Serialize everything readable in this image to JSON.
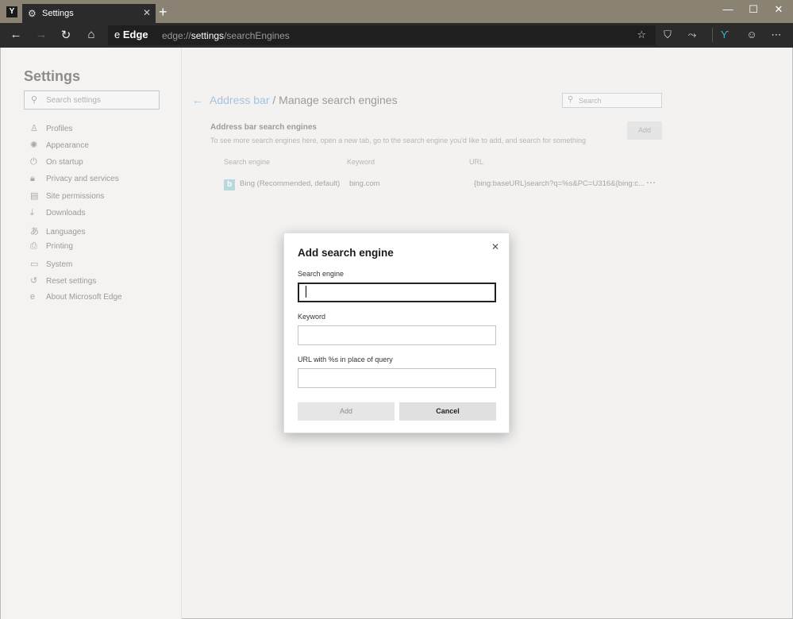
{
  "browser": {
    "tab_title": "Settings",
    "new_tab_symbol": "+",
    "address_brand": "Edge",
    "url_scheme": "edge://",
    "url_host": "settings",
    "url_path": "/searchEngines",
    "icons": [
      "settings-gear-icon",
      "tab-close-icon",
      "back-icon",
      "forward-icon",
      "refresh-icon",
      "home-icon",
      "favorite-star-icon",
      "shield-icon",
      "share-icon",
      "profile-icon",
      "emoji-icon",
      "more-icon"
    ]
  },
  "sidebar": {
    "title": "Settings",
    "search_placeholder": "Search settings",
    "items": [
      {
        "label": "Profiles",
        "icon": "person-icon"
      },
      {
        "label": "Appearance",
        "icon": "palette-icon"
      },
      {
        "label": "On startup",
        "icon": "power-icon"
      },
      {
        "label": "Privacy and services",
        "icon": "lock-icon"
      },
      {
        "label": "Site permissions",
        "icon": "permissions-icon"
      },
      {
        "label": "Downloads",
        "icon": "download-icon"
      },
      {
        "label": "Languages",
        "icon": "language-icon"
      },
      {
        "label": "Printing",
        "icon": "printer-icon"
      },
      {
        "label": "System",
        "icon": "laptop-icon"
      },
      {
        "label": "Reset settings",
        "icon": "reset-icon"
      },
      {
        "label": "About Microsoft Edge",
        "icon": "edge-icon"
      }
    ]
  },
  "main": {
    "breadcrumb_link": "Address bar",
    "breadcrumb_current": "/ Manage search engines",
    "search_placeholder": "Search",
    "section_title": "Address bar search engines",
    "section_desc": "To see more search engines here, open a new tab, go to the search engine you'd like to add, and search for something",
    "add_label": "Add",
    "columns": [
      "Search engine",
      "Keyword",
      "URL"
    ],
    "rows": [
      {
        "engine": "Bing (Recommended, default)",
        "keyword": "bing.com",
        "url": "{bing:baseURL}search?q=%s&PC=U316&{bing:c..."
      }
    ]
  },
  "dialog": {
    "title": "Add search engine",
    "field1_label": "Search engine",
    "field1_value": "",
    "field2_label": "Keyword",
    "field2_value": "",
    "field3_label": "URL with %s in place of query",
    "field3_value": "",
    "add_label": "Add",
    "cancel_label": "Cancel"
  }
}
